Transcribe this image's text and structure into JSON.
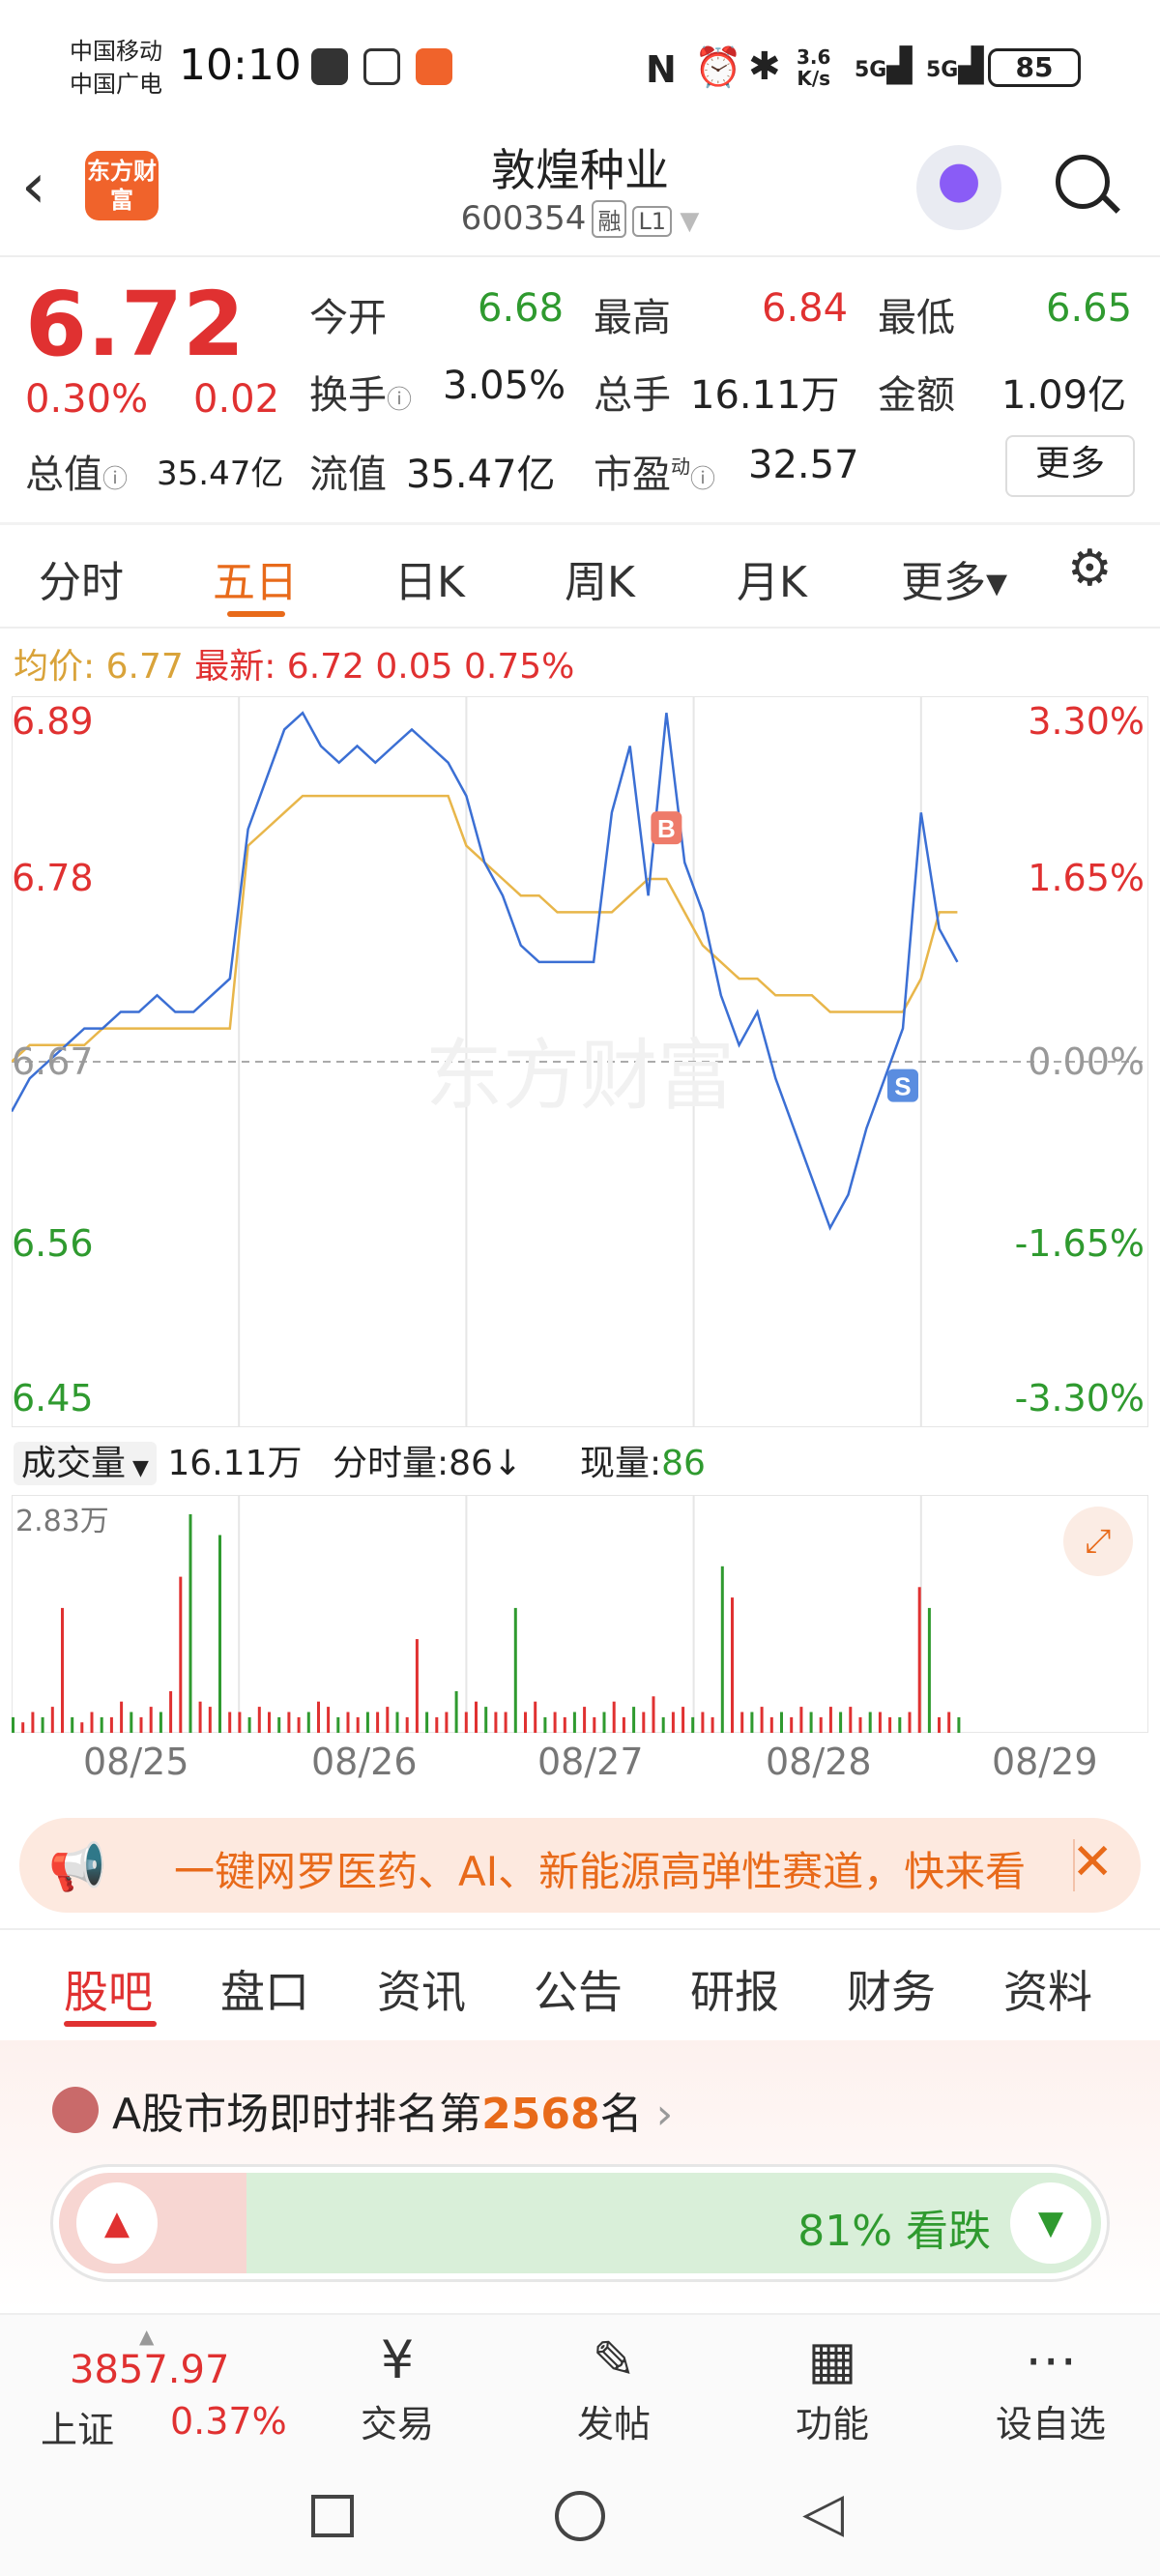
{
  "status_bar": {
    "carrier_1": "中国移动",
    "carrier_2": "中国广电",
    "time": "10:10",
    "net_speed_top": "3.6",
    "net_speed_bottom": "K/s",
    "signal_1": "5G",
    "signal_2": "5G",
    "battery": "85"
  },
  "header": {
    "logo_text": "东方财富",
    "title": "敦煌种业",
    "code": "600354",
    "tag_margin": "融",
    "tag_level": "L1"
  },
  "quote": {
    "price": "6.72",
    "change_pct": "0.30%",
    "change_abs": "0.02",
    "open_label": "今开",
    "open": "6.68",
    "high_label": "最高",
    "high": "6.84",
    "low_label": "最低",
    "low": "6.65",
    "turnover_label": "换手",
    "turnover": "3.05%",
    "volume_label": "总手",
    "volume": "16.11万",
    "amount_label": "金额",
    "amount": "1.09亿",
    "mktcap_label": "总值",
    "mktcap": "35.47亿",
    "float_label": "流值",
    "float": "35.47亿",
    "pe_label": "市盈",
    "pe_sup": "动",
    "pe": "32.57",
    "more_label": "更多"
  },
  "chart_tabs": [
    "分时",
    "五日",
    "日K",
    "周K",
    "月K",
    "更多▾"
  ],
  "chart_info": {
    "avg_label": "均价:",
    "avg": "6.77",
    "latest_label": "最新:",
    "latest": "6.72",
    "chg": "0.05",
    "chg_pct": "0.75%",
    "watermark": "东方财富"
  },
  "chart_data": {
    "type": "line",
    "left_ticks": [
      "6.89",
      "6.78",
      "6.67",
      "6.56",
      "6.45"
    ],
    "right_ticks": [
      "3.30%",
      "1.65%",
      "0.00%",
      "-1.65%",
      "-3.30%"
    ],
    "ylim": [
      6.45,
      6.89
    ],
    "x_labels": [
      "08/25",
      "08/26",
      "08/27",
      "08/28",
      "08/29"
    ],
    "series": [
      {
        "values": [
          6.64,
          6.66,
          6.67,
          6.68,
          6.69,
          6.69,
          6.7,
          6.7,
          6.71,
          6.7,
          6.7,
          6.71,
          6.72,
          6.81,
          6.84,
          6.87,
          6.88,
          6.86,
          6.85,
          6.86,
          6.85,
          6.86,
          6.87,
          6.86,
          6.85,
          6.83,
          6.79,
          6.77,
          6.74,
          6.73,
          6.73,
          6.73,
          6.73,
          6.82,
          6.86,
          6.77,
          6.88,
          6.79,
          6.76,
          6.71,
          6.68,
          6.7,
          6.66,
          6.63,
          6.6,
          6.57,
          6.59,
          6.63,
          6.66,
          6.69,
          6.82,
          6.75,
          6.73
        ]
      },
      {
        "values": [
          6.67,
          6.68,
          6.68,
          6.68,
          6.68,
          6.69,
          6.69,
          6.69,
          6.69,
          6.69,
          6.69,
          6.69,
          6.69,
          6.8,
          6.81,
          6.82,
          6.83,
          6.83,
          6.83,
          6.83,
          6.83,
          6.83,
          6.83,
          6.83,
          6.83,
          6.8,
          6.79,
          6.78,
          6.77,
          6.77,
          6.76,
          6.76,
          6.76,
          6.76,
          6.77,
          6.78,
          6.78,
          6.76,
          6.74,
          6.73,
          6.72,
          6.72,
          6.71,
          6.71,
          6.71,
          6.7,
          6.7,
          6.7,
          6.7,
          6.7,
          6.72,
          6.76,
          6.76
        ]
      }
    ],
    "markers": [
      {
        "label": "B"
      },
      {
        "label": "S"
      }
    ],
    "volume_max": "2.83万",
    "volume": [
      3,
      2,
      4,
      3,
      5,
      24,
      3,
      2,
      4,
      3,
      3,
      6,
      4,
      3,
      5,
      4,
      8,
      30,
      42,
      6,
      5,
      38,
      4,
      4,
      3,
      5,
      4,
      3,
      4,
      3,
      4,
      6,
      5,
      3,
      4,
      3,
      4,
      4,
      5,
      4,
      3,
      18,
      4,
      3,
      4,
      8,
      4,
      6,
      5,
      4,
      4,
      24,
      4,
      6,
      3,
      4,
      3,
      4,
      5,
      3,
      4,
      6,
      3,
      5,
      4,
      7,
      3,
      4,
      5,
      3,
      4,
      3,
      32,
      26,
      4,
      4,
      5,
      3,
      4,
      3,
      5,
      4,
      3,
      5,
      4,
      5,
      3,
      4,
      4,
      3,
      3,
      4,
      28,
      24,
      3,
      4,
      3
    ]
  },
  "volume_info": {
    "vol_label": "成交量",
    "vol": "16.11万",
    "tick_label": "分时量:",
    "tick": "86↓",
    "now_label": "现量:",
    "now": "86"
  },
  "banner": {
    "text": "一键网罗医药、AI、新能源高弹性赛道，快来看"
  },
  "sub_tabs": [
    "股吧",
    "盘口",
    "资讯",
    "公告",
    "研报",
    "财务",
    "资料"
  ],
  "ranking": {
    "prefix": "A股市场即时排名第",
    "rank": "2568",
    "suffix": "名",
    "vote_label": "81% 看跌"
  },
  "bottom_bar": {
    "index_value": "3857.97",
    "index_name": "上证",
    "index_change": "0.37%",
    "items": [
      "交易",
      "发帖",
      "功能",
      "设自选"
    ]
  },
  "colors": {
    "up": "#e03131",
    "down": "#2f9a2f",
    "accent": "#e86a1a",
    "price_line": "#3b6fd4",
    "avg_line": "#e8b64a"
  }
}
